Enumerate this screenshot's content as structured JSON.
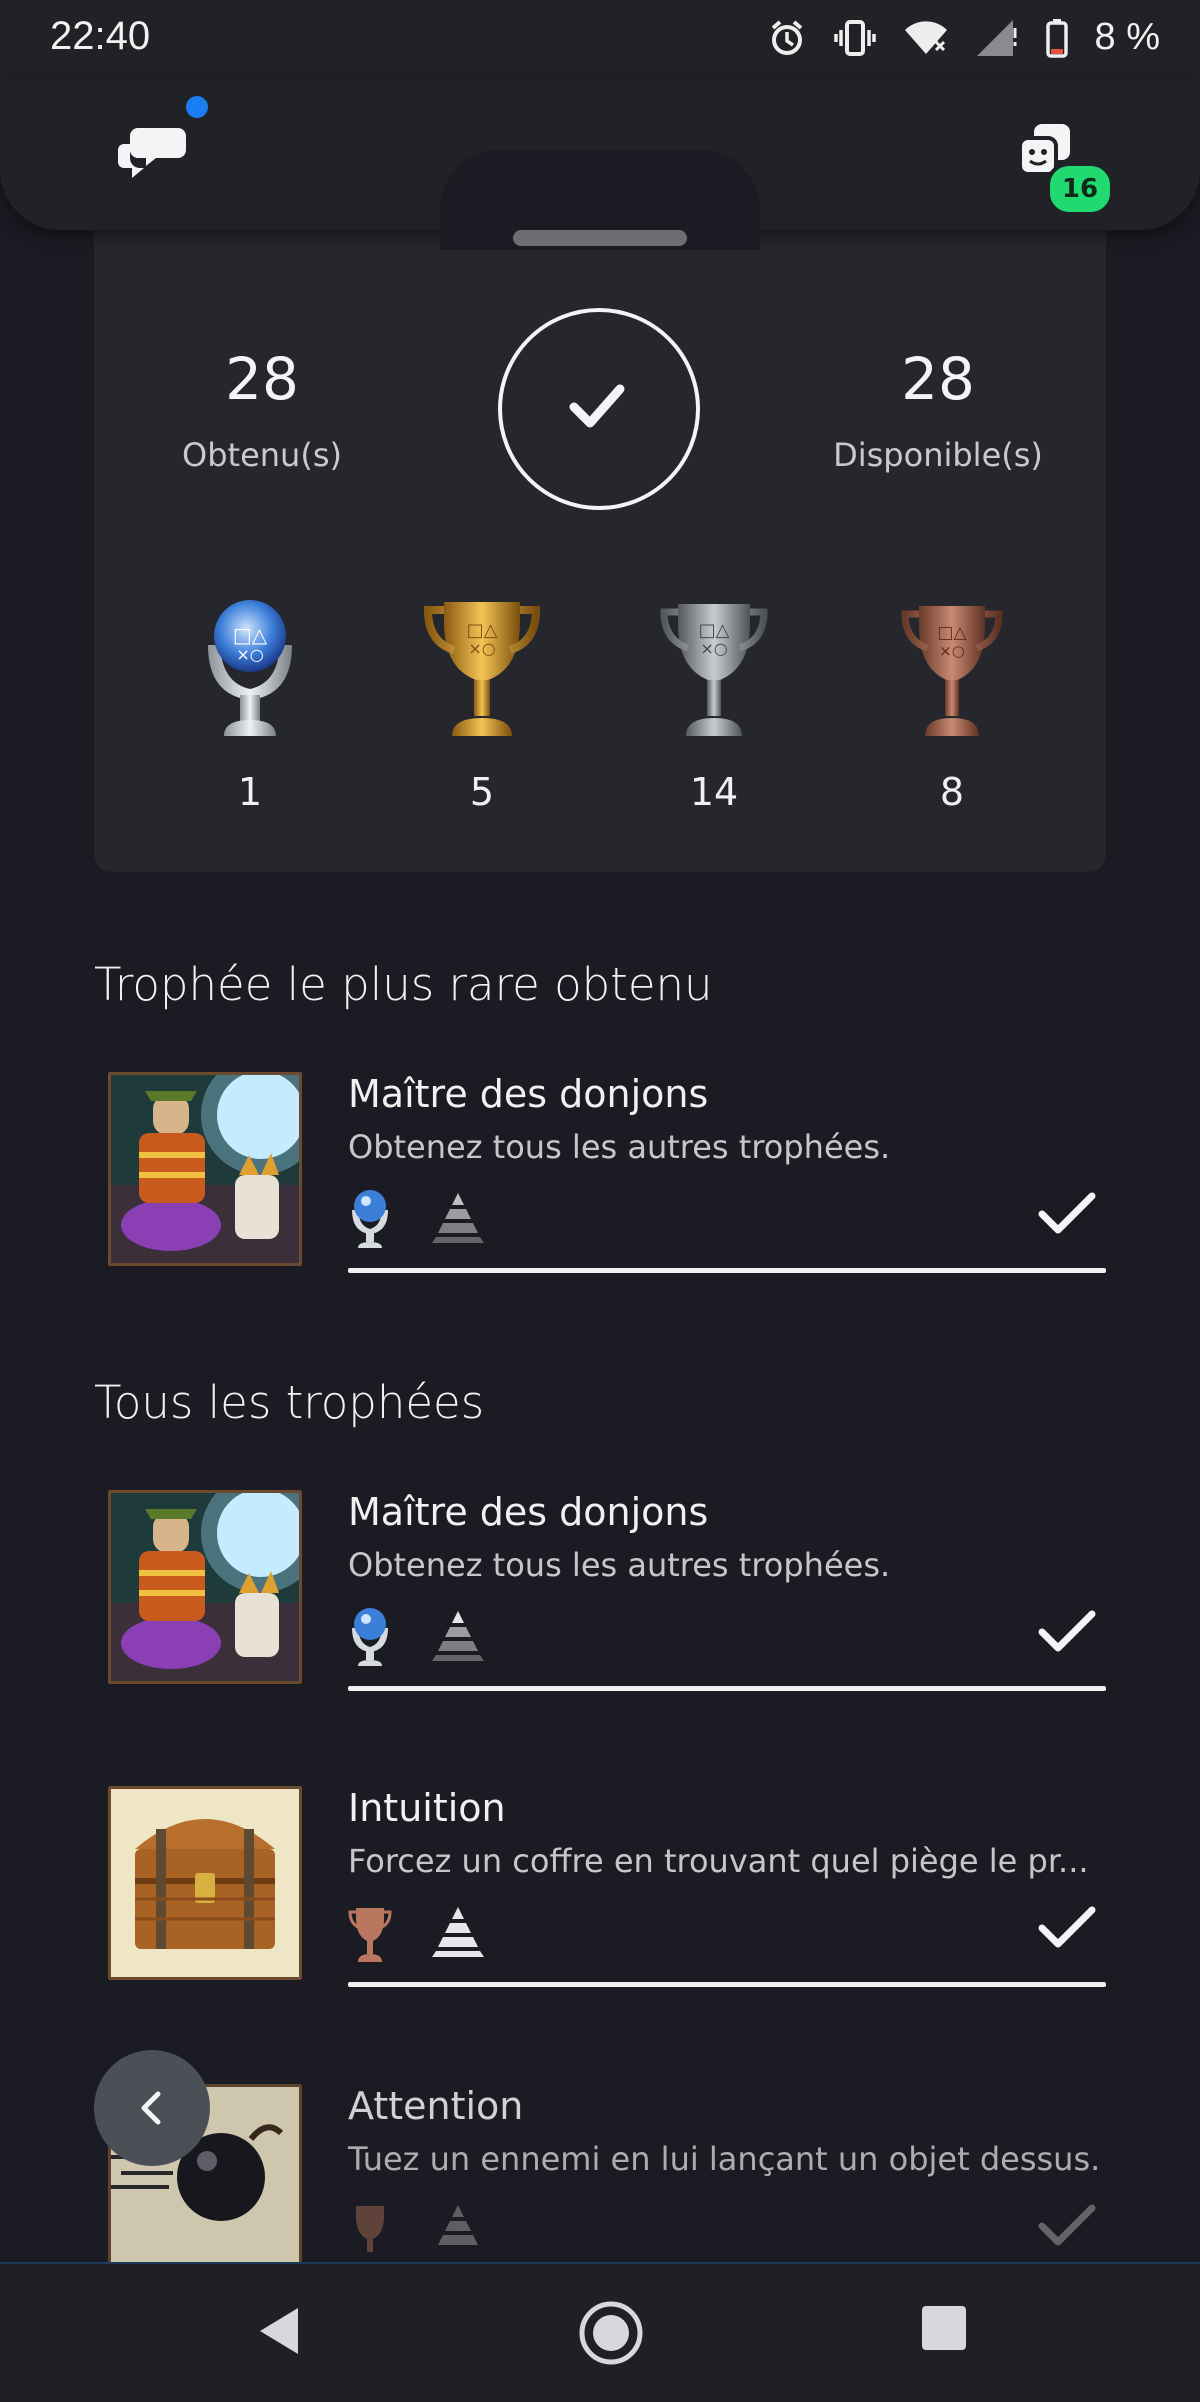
{
  "status_bar": {
    "time": "22:40",
    "battery": "8 %"
  },
  "top_bar": {
    "chat_icon": "chat-bubbles-icon",
    "friends_icon": "friends-icon",
    "friends_badge": "16"
  },
  "summary": {
    "earned_count": "28",
    "earned_label": "Obtenu(s)",
    "available_count": "28",
    "available_label": "Disponible(s)",
    "platinum": "1",
    "gold": "5",
    "silver": "14",
    "bronze": "8"
  },
  "sections": {
    "rarest": "Trophée le plus rare obtenu",
    "all": "Tous les trophées"
  },
  "rarest_trophy": {
    "name": "Maître des donjons",
    "description": "Obtenez tous les autres trophées.",
    "grade": "platinum",
    "earned": true
  },
  "trophies": [
    {
      "name": "Maître des donjons",
      "description": "Obtenez tous les autres trophées.",
      "grade": "platinum",
      "earned": true
    },
    {
      "name": "Intuition",
      "description": "Forcez un coffre en trouvant quel piège le pr...",
      "grade": "bronze",
      "earned": true
    },
    {
      "name": "Attention",
      "description": "Tuez un ennemi en lui lançant un objet dessus.",
      "grade": "bronze",
      "earned": true
    }
  ],
  "colors": {
    "background": "#1b1b24",
    "card": "#25272d",
    "badge_green": "#20d970",
    "dot_blue": "#1a7ef2"
  }
}
